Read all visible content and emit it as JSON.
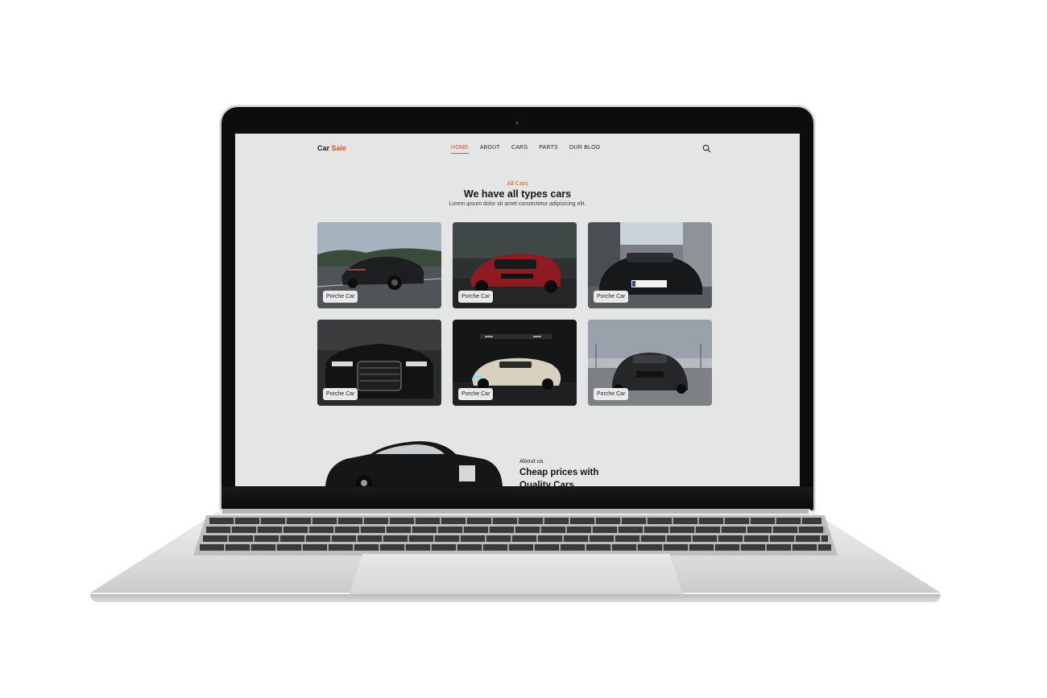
{
  "site": {
    "logo_part1": "Car",
    "logo_part2": "Sale"
  },
  "nav": {
    "items": [
      {
        "label": "HOME",
        "active": true
      },
      {
        "label": "ABOUT",
        "active": false
      },
      {
        "label": "CARS",
        "active": false
      },
      {
        "label": "PARTS",
        "active": false
      },
      {
        "label": "OUR BLOG",
        "active": false
      }
    ],
    "search_icon": "search-icon"
  },
  "cars_section": {
    "kicker": "All Cars",
    "title": "We have all types cars",
    "lead": "Lorem ipsum dolor sit amet consectetur adipisicing elit.",
    "cards": [
      {
        "label": "Porche Car",
        "color": "#1d1e20"
      },
      {
        "label": "Porche Car",
        "color": "#8e1a22"
      },
      {
        "label": "Porche Car",
        "color": "#17181a"
      },
      {
        "label": "Porche Car",
        "color": "#131313"
      },
      {
        "label": "Porche Car",
        "color": "#d8cfbe"
      },
      {
        "label": "Porche Car",
        "color": "#252729"
      }
    ]
  },
  "about": {
    "kicker": "About us",
    "title": "Cheap prices with Quality Cars"
  },
  "colors": {
    "accent": "#e0531e",
    "background": "#e4e5e5"
  }
}
